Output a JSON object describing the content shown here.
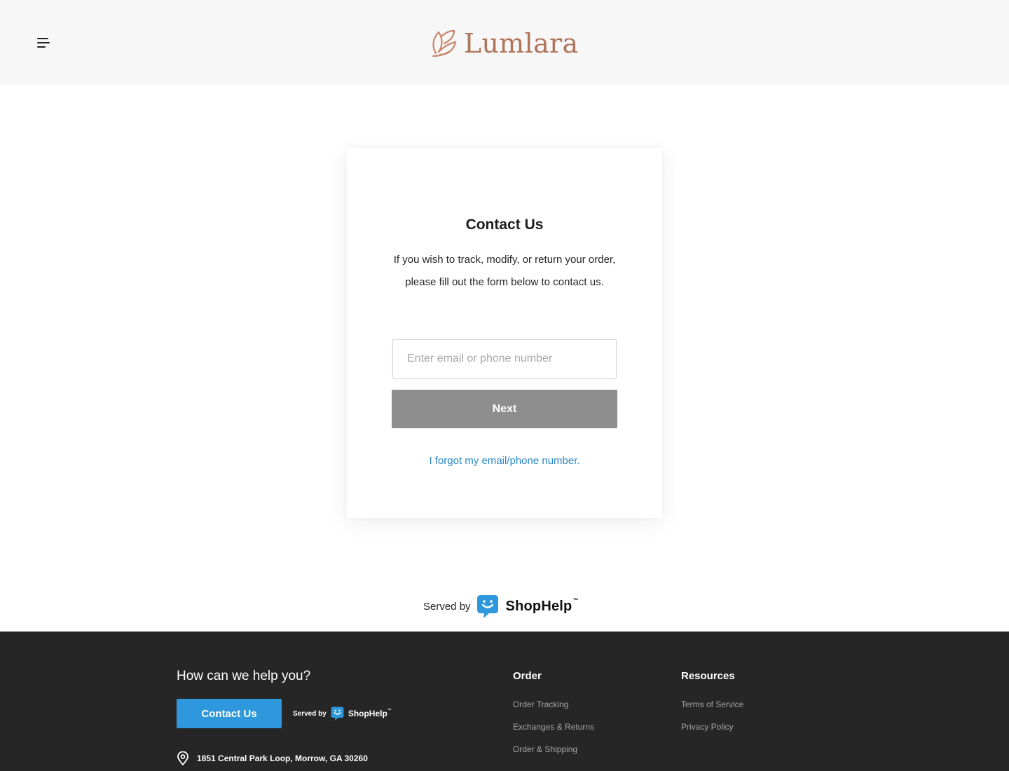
{
  "header": {
    "menu_icon": "hamburger-menu-icon",
    "logo_text": "Lumlara",
    "logo_mark_icon": "lotus-leaf-icon",
    "brand_color": "#b0745a"
  },
  "card": {
    "title": "Contact Us",
    "description": "If you wish to track, modify, or return your order, please fill out the form below to contact us.",
    "input": {
      "value": "",
      "placeholder": "Enter email or phone number"
    },
    "next_label": "Next",
    "next_color": "#8e8e8e",
    "forgot_label": "I forgot my email/phone number.",
    "link_color": "#2c88c9"
  },
  "served_by": {
    "label": "Served by",
    "brand": "ShopHelp",
    "trademark": "™",
    "icon": "shophelp-smile-icon",
    "icon_color": "#2f98dc"
  },
  "footer": {
    "background": "#262626",
    "help_title": "How can we help you?",
    "contact_button": "Contact Us",
    "served_label": "Served by",
    "served_brand": "ShopHelp",
    "served_tm": "™",
    "address_icon": "map-pin-icon",
    "address": "1851 Central Park Loop, Morrow, GA 30260",
    "columns": [
      {
        "title": "Order",
        "links": [
          "Order Tracking",
          "Exchanges & Returns",
          "Order & Shipping"
        ]
      },
      {
        "title": "Resources",
        "links": [
          "Terms of Service",
          "Privacy Policy"
        ]
      }
    ]
  }
}
